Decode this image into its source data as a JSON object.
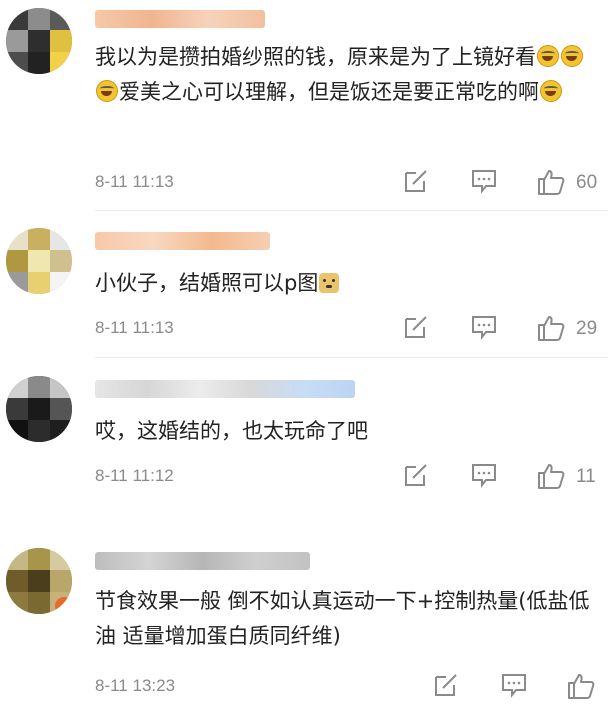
{
  "comments": [
    {
      "text_a": "我以为是攒拍婚纱照的钱，原来是为了上镜好看",
      "text_b": "爱美之心可以理解，但是饭还是要正常吃的啊",
      "emoji": "laughing-crying-emoji",
      "time": "8-11 11:13",
      "likes": "60"
    },
    {
      "text_a": "小伙子，结婚照可以p图",
      "emoji": "doge-emoji",
      "time": "8-11 11:13",
      "likes": "29"
    },
    {
      "text_a": "哎，这婚结的，也太玩命了吧",
      "time": "8-11 11:12",
      "likes": "11"
    },
    {
      "text_a": "节食效果一般 倒不如认真运动一下+控制热量(低盐低油 适量增加蛋白质同纤维)",
      "time": "8-11 13:23",
      "likes": ""
    }
  ],
  "icons": {
    "repost": "share-edit-icon",
    "reply": "comment-bubble-icon",
    "like": "thumbs-up-icon"
  }
}
